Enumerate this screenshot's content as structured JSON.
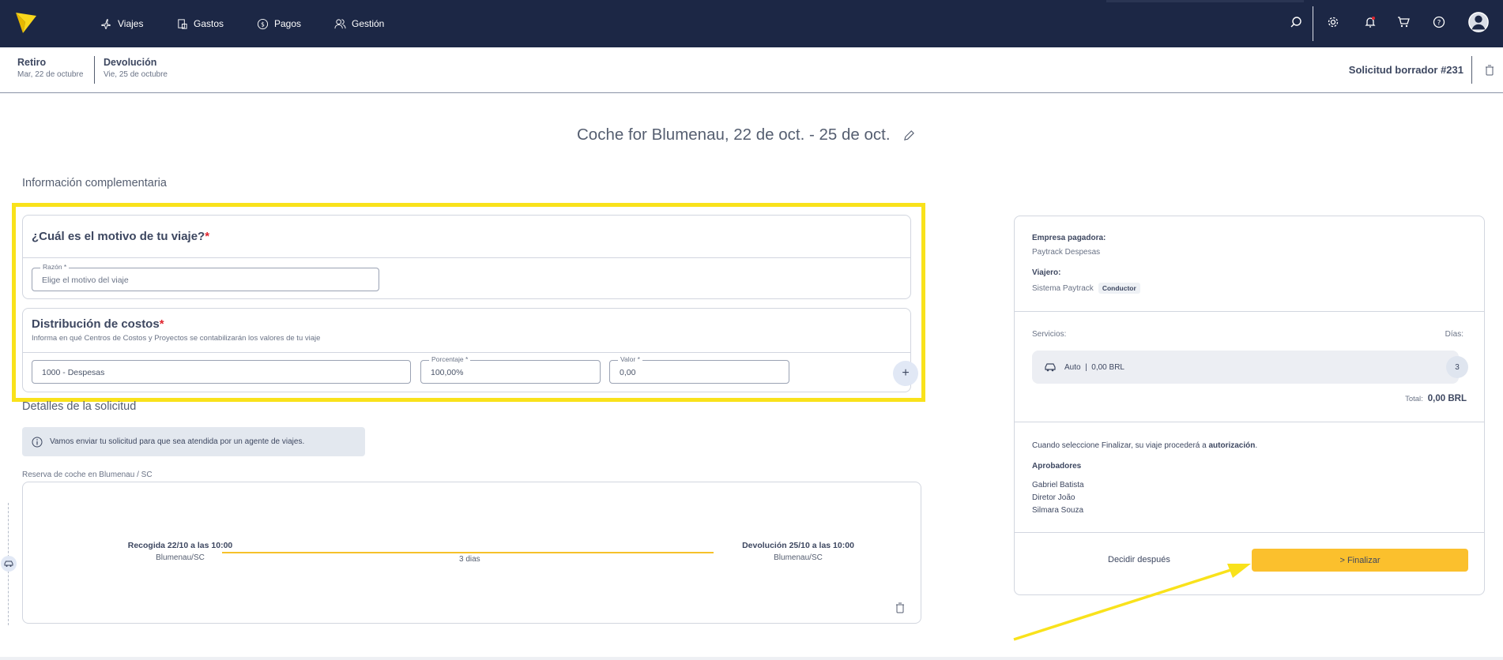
{
  "nav": {
    "items": [
      {
        "label": "Viajes",
        "icon": "plane-icon"
      },
      {
        "label": "Gastos",
        "icon": "receipt-icon"
      },
      {
        "label": "Pagos",
        "icon": "dollar-icon"
      },
      {
        "label": "Gestión",
        "icon": "users-icon"
      }
    ],
    "right_icons": [
      "search-icon",
      "gear-icon",
      "bell-icon",
      "cart-icon",
      "help-icon",
      "avatar-icon"
    ]
  },
  "subheader": {
    "pickup_title": "Retiro",
    "pickup_date": "Mar, 22 de octubre",
    "return_title": "Devolución",
    "return_date": "Vie, 25 de octubre",
    "draft": "Solicitud borrador #231"
  },
  "page": {
    "title": "Coche for Blumenau, 22 de oct. - 25 de oct.",
    "section_complementary": "Información complementaria",
    "section_details": "Detalles de la solicitud"
  },
  "reason": {
    "heading": "¿Cuál es el motivo de tu viaje?",
    "required_mark": "*",
    "field_label": "Razón *",
    "field_placeholder": "Elige el motivo del viaje"
  },
  "costs": {
    "heading": "Distribución de costos",
    "required_mark": "*",
    "subtitle": "Informa en qué Centros de Costos y Proyectos se contabilizarán los valores de tu viaje",
    "center_value": "1000 - Despesas",
    "percent_label": "Porcentaje *",
    "percent_value": "100,00%",
    "value_label": "Valor *",
    "value_value": "0,00",
    "add_symbol": "+"
  },
  "details": {
    "info_text": "Vamos enviar tu solicitud para que sea atendida por un agente de viajes.",
    "reservation_label": "Reserva de coche en Blumenau / SC",
    "pickup_line": "Recogida 22/10 a las 10:00",
    "pickup_city": "Blumenau/SC",
    "return_line": "Devolución 25/10 a las 10:00",
    "return_city": "Blumenau/SC",
    "duration": "3 dias"
  },
  "summary": {
    "company_label": "Empresa pagadora:",
    "company_value": "Paytrack Despesas",
    "traveler_label": "Viajero:",
    "traveler_value": "Sistema Paytrack",
    "traveler_badge": "Conductor",
    "services_label": "Servicios:",
    "days_label": "Días:",
    "service_text": "Auto  |  0,00 BRL",
    "service_days": "3",
    "total_label": "Total:",
    "total_value": "0,00 BRL",
    "auth_text_pre": "Cuando seleccione Finalizar, su viaje procederá a ",
    "auth_text_bold": "autorización",
    "auth_text_post": ".",
    "approvers_label": "Aprobadores",
    "approvers": [
      "Gabriel Batista",
      "Diretor João",
      "Silmara Souza"
    ],
    "decide_later": "Decidir después",
    "finalize": "> Finalizar"
  },
  "colors": {
    "topbar": "#1c2745",
    "highlight": "#f9e21b",
    "primary_button": "#fbc02d",
    "required": "#e0262f"
  }
}
